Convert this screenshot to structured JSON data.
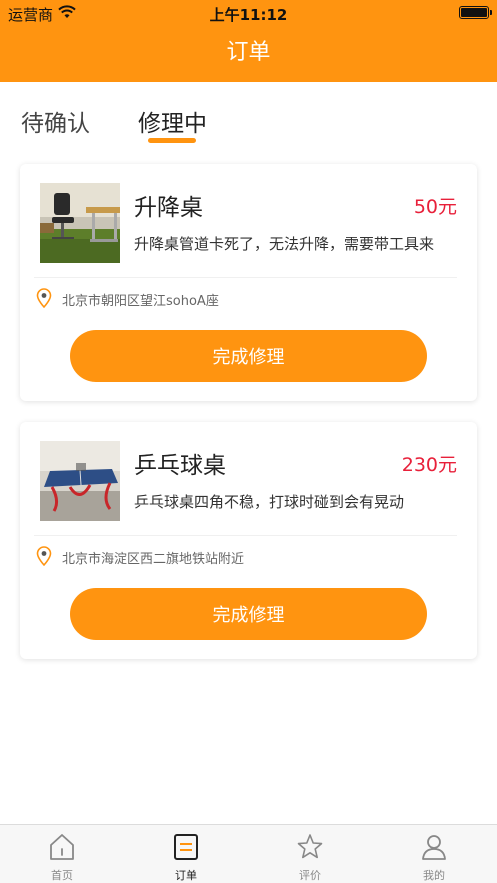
{
  "status_bar": {
    "carrier": "运营商",
    "time": "上午11:12"
  },
  "header": {
    "title": "订单"
  },
  "tabs": [
    {
      "label": "待确认",
      "active": false
    },
    {
      "label": "修理中",
      "active": true
    }
  ],
  "orders": [
    {
      "title": "升降桌",
      "price": "50元",
      "description": "升降桌管道卡死了，无法升降，需要带工具来",
      "address": "北京市朝阳区望江sohoA座",
      "button_label": "完成修理",
      "image": "office-desk-photo"
    },
    {
      "title": "乒乓球桌",
      "price": "230元",
      "description": "乒乓球桌四角不稳，打球时碰到会有晃动",
      "address": "北京市海淀区西二旗地铁站附近",
      "button_label": "完成修理",
      "image": "ping-pong-table-photo"
    }
  ],
  "tabbar": [
    {
      "label": "首页",
      "icon": "home-icon",
      "active": false
    },
    {
      "label": "订单",
      "icon": "order-icon",
      "active": true
    },
    {
      "label": "评价",
      "icon": "star-icon",
      "active": false
    },
    {
      "label": "我的",
      "icon": "user-icon",
      "active": false
    }
  ],
  "colors": {
    "accent": "#ff9410",
    "price": "#e8203a"
  }
}
